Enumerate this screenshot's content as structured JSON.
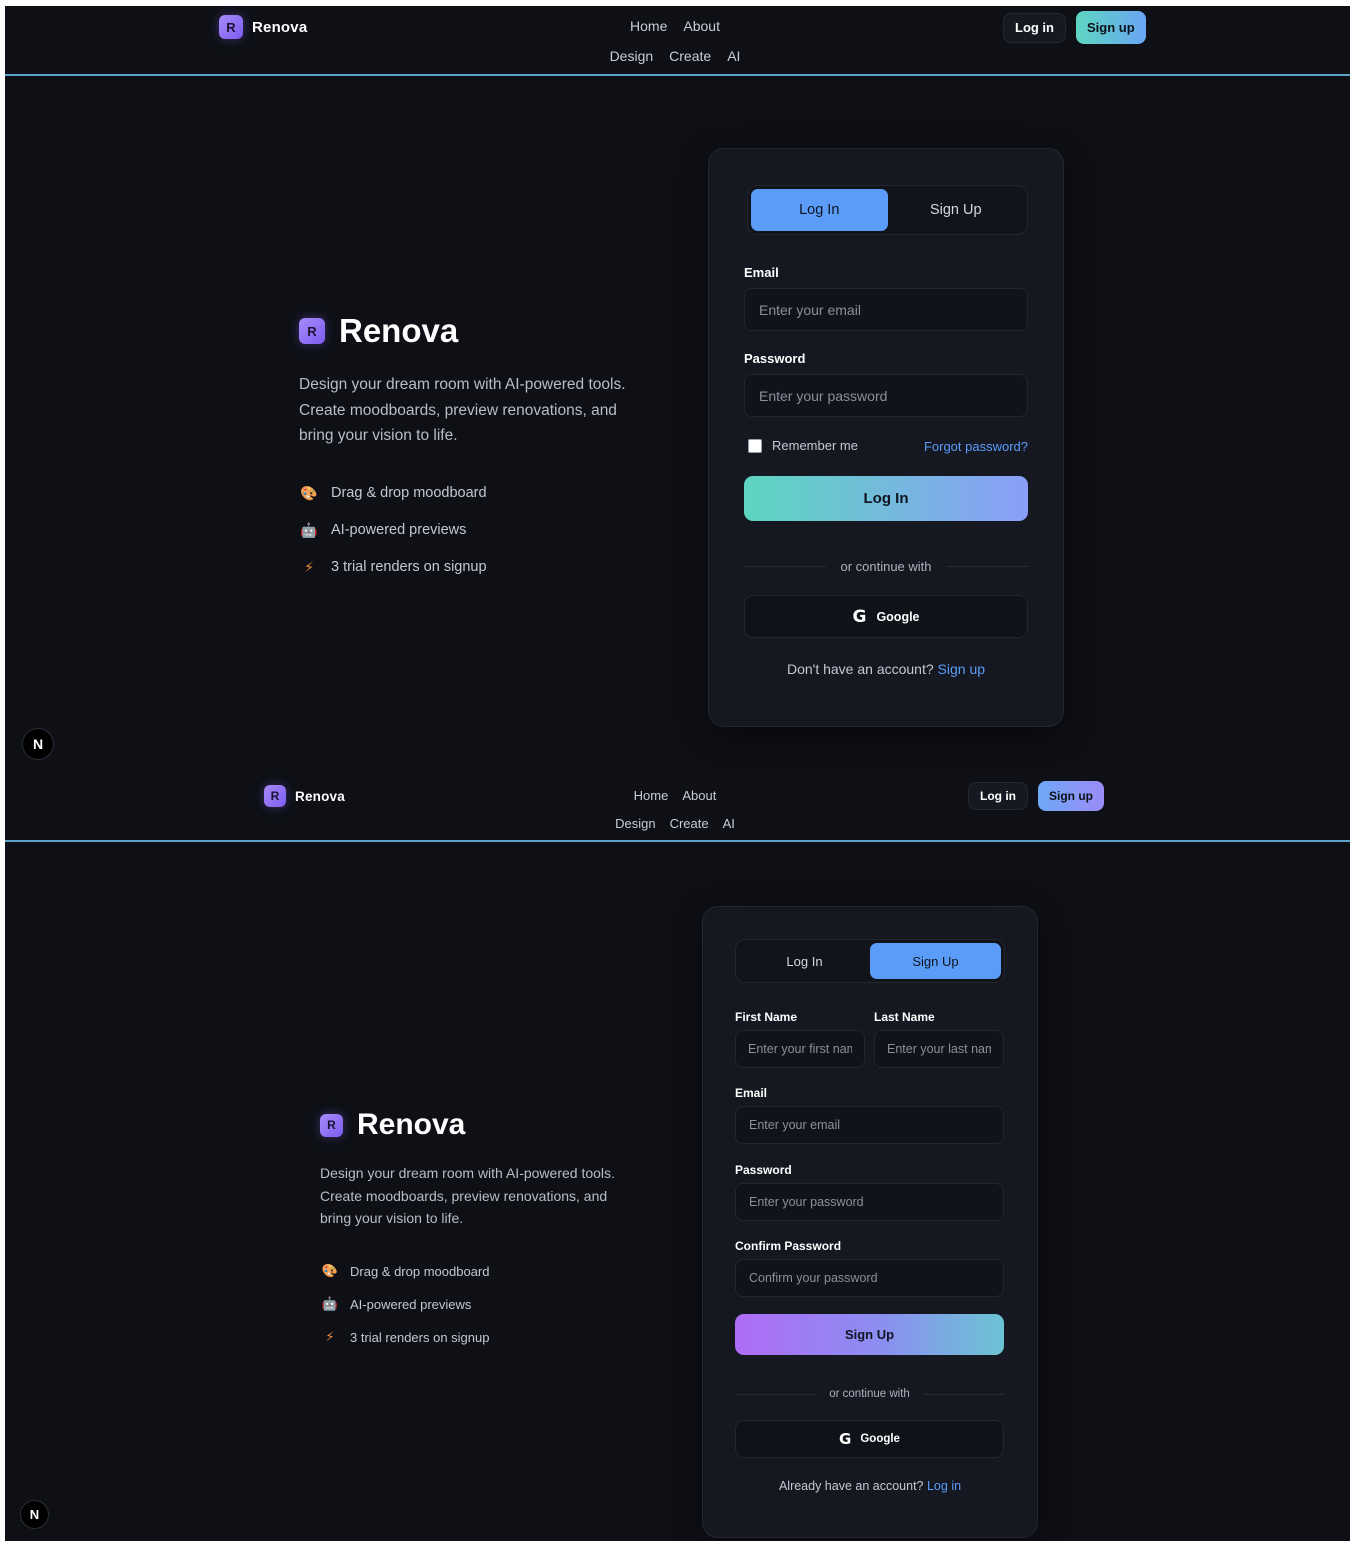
{
  "brand": {
    "logo_letter": "R",
    "name": "Renova"
  },
  "nav": {
    "home": "Home",
    "about": "About",
    "design": "Design",
    "create": "Create",
    "ai": "AI",
    "login": "Log in",
    "signup": "Sign up"
  },
  "hero": {
    "title": "Renova",
    "description_lines": [
      "Design your dream room with AI-powered tools.",
      "Create moodboards, preview renovations, and",
      "bring your vision to life."
    ],
    "features": [
      {
        "icon": "palette-icon",
        "text": "Drag & drop moodboard"
      },
      {
        "icon": "robot-icon",
        "text": "AI-powered previews"
      },
      {
        "icon": "lightning-icon",
        "text": "3 trial renders on signup"
      }
    ]
  },
  "tabs": {
    "login": "Log In",
    "signup": "Sign Up"
  },
  "login_form": {
    "email_label": "Email",
    "email_placeholder": "Enter your email",
    "password_label": "Password",
    "password_placeholder": "Enter your password",
    "remember_me": "Remember me",
    "forgot_password": "Forgot password?",
    "submit": "Log In",
    "divider": "or continue with",
    "google": "Google",
    "footer_text": "Don't have an account?",
    "footer_link": "Sign up"
  },
  "signup_form": {
    "first_name_label": "First Name",
    "first_name_placeholder": "Enter your first name",
    "last_name_label": "Last Name",
    "last_name_placeholder": "Enter your last name",
    "email_label": "Email",
    "email_placeholder": "Enter your email",
    "password_label": "Password",
    "password_placeholder": "Enter your password",
    "confirm_label": "Confirm Password",
    "confirm_placeholder": "Confirm your password",
    "submit": "Sign Up",
    "divider": "or continue with",
    "google": "Google",
    "footer_text": "Already have an account?",
    "footer_link": "Log in"
  },
  "badge": "N",
  "colors": {
    "accent_blue": "#5b9cf8",
    "teal": "#5dd6c0",
    "purple": "#b06cf7",
    "background": "#0e1016",
    "card": "#151821"
  }
}
